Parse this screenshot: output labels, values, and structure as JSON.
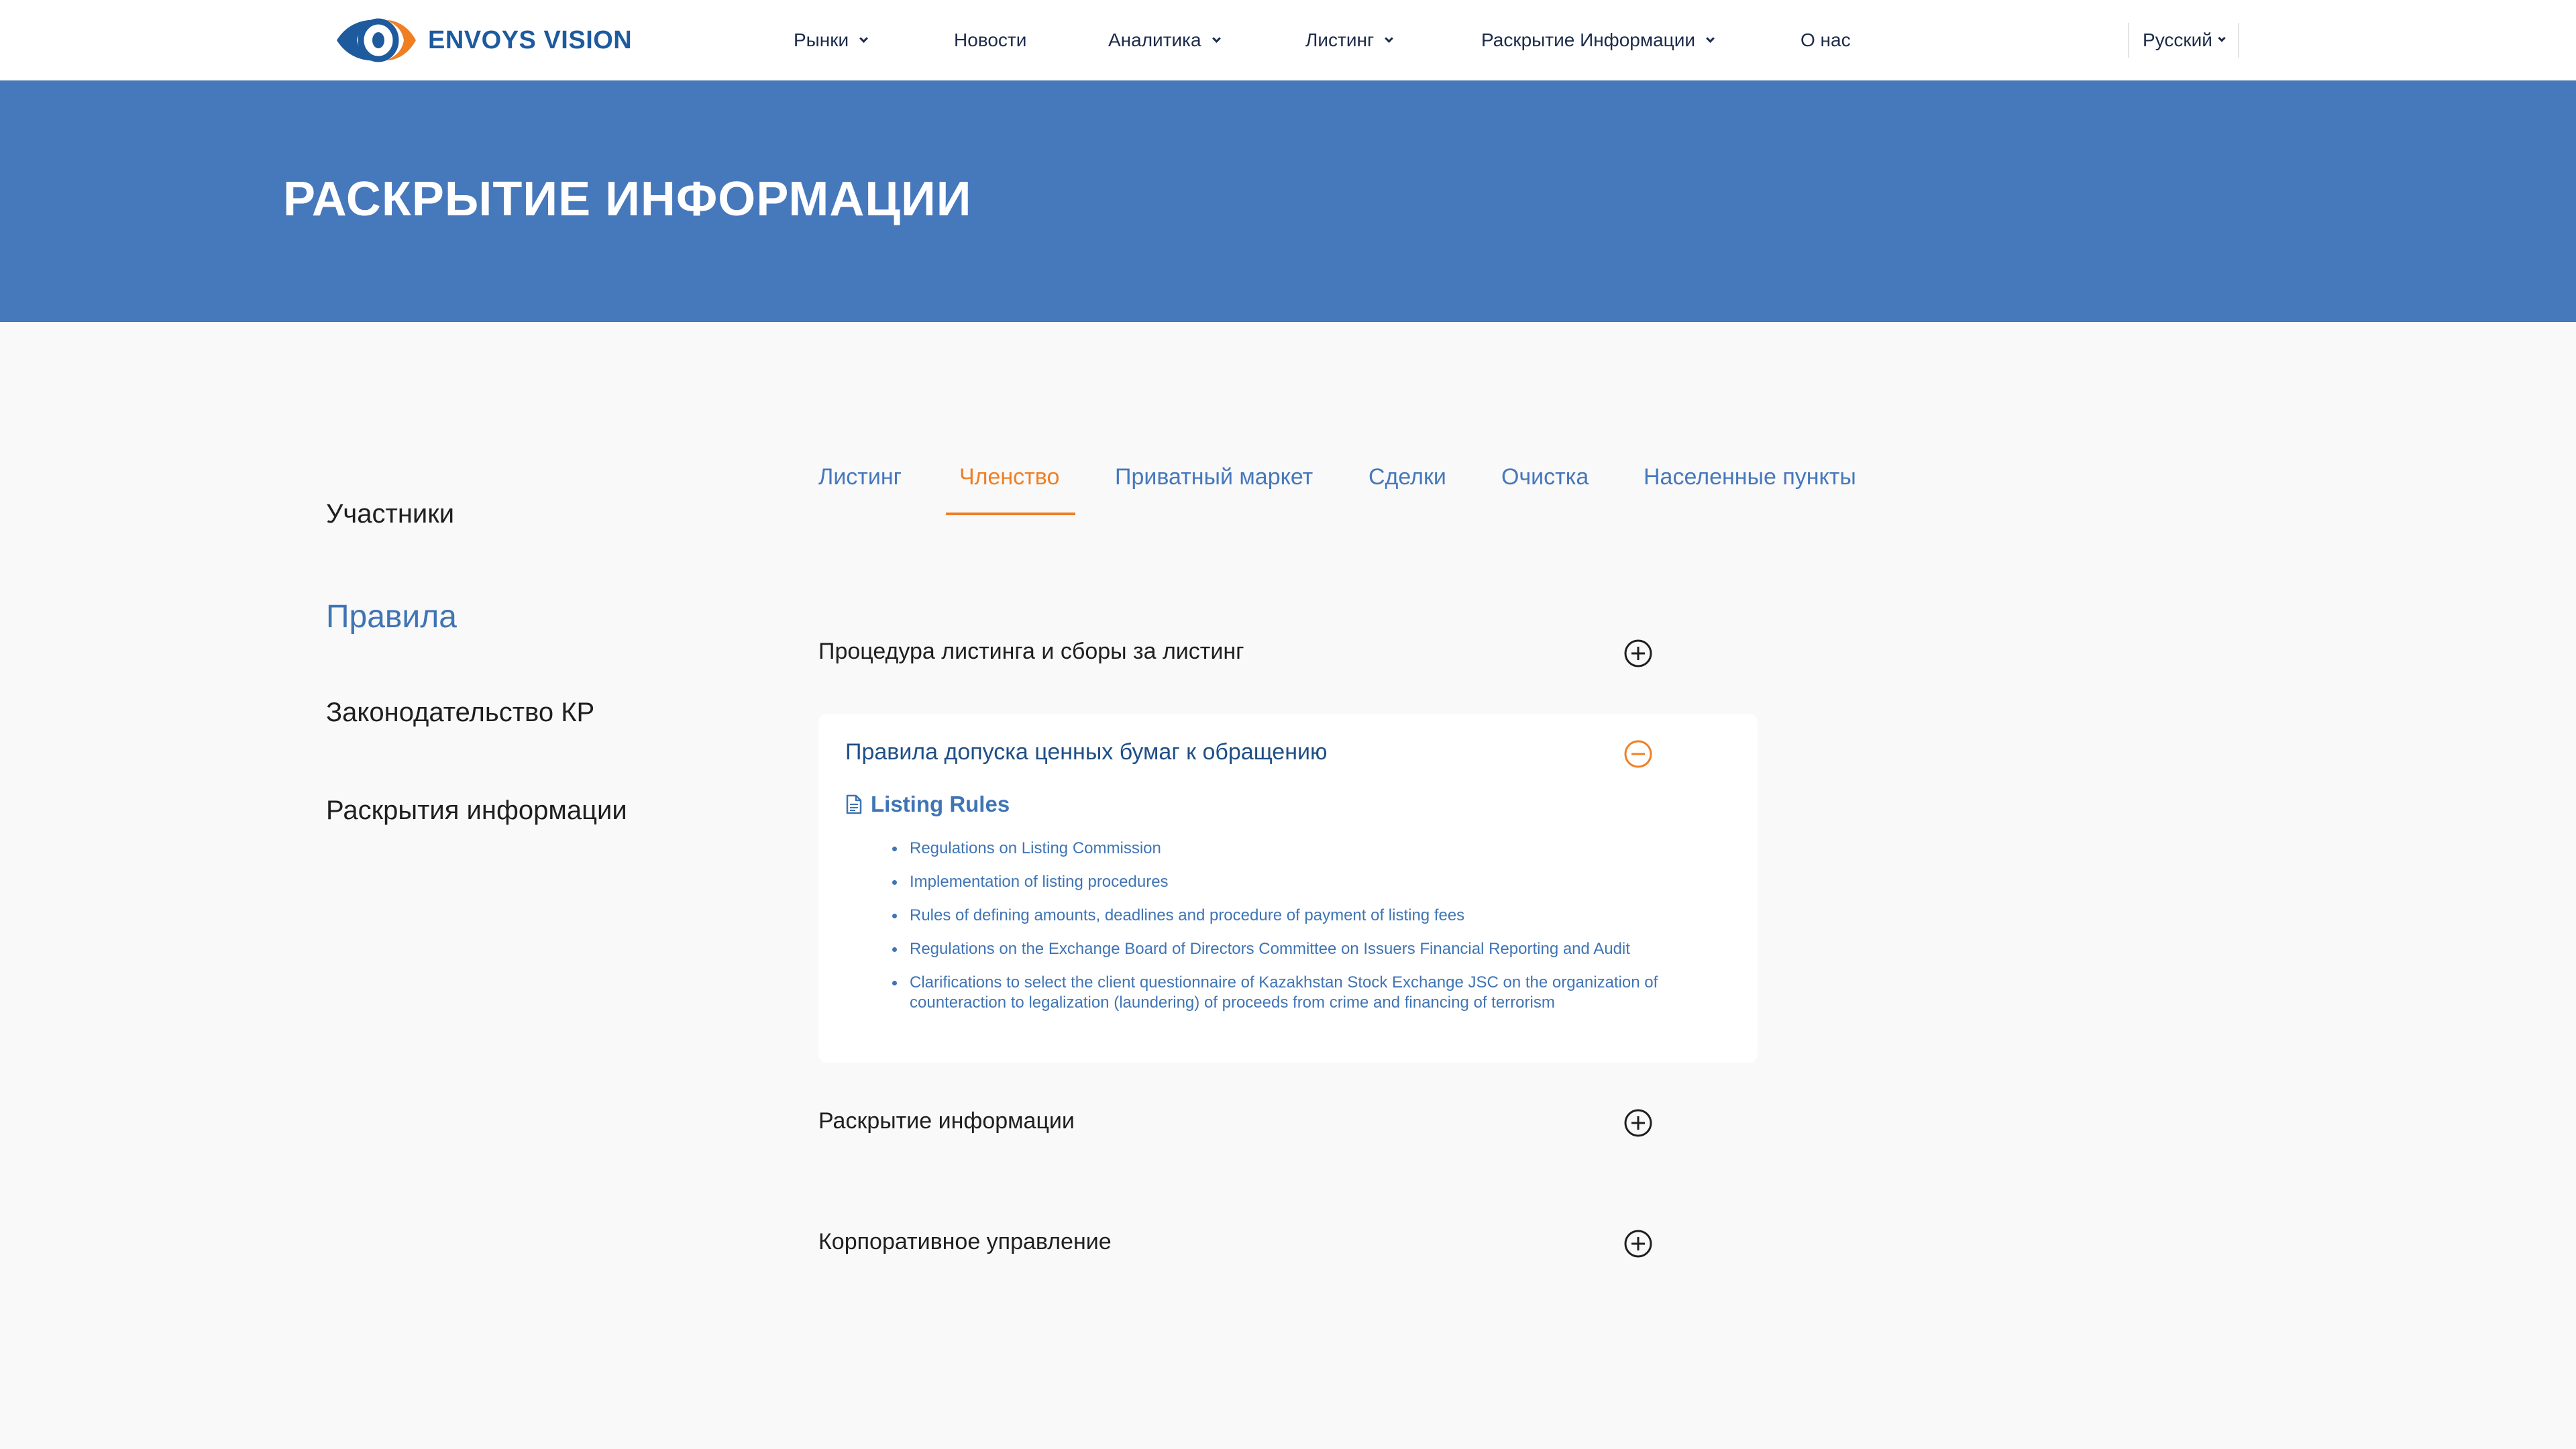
{
  "header": {
    "brand": "ENVOYS VISION",
    "nav": [
      {
        "label": "Рынки",
        "has_dropdown": true
      },
      {
        "label": "Новости",
        "has_dropdown": false
      },
      {
        "label": "Аналитика",
        "has_dropdown": true
      },
      {
        "label": "Листинг",
        "has_dropdown": true
      },
      {
        "label": "Раскрытие Информации",
        "has_dropdown": true
      },
      {
        "label": "О нас",
        "has_dropdown": false
      }
    ],
    "language": "Русский"
  },
  "banner": {
    "title": "РАСКРЫТИЕ ИНФОРМАЦИИ"
  },
  "sidebar": {
    "items": [
      {
        "label": "Участники",
        "active": false
      },
      {
        "label": "Правила",
        "active": true
      },
      {
        "label": "Законодательство КР",
        "active": false
      },
      {
        "label": "Раскрытия информации",
        "active": false
      }
    ]
  },
  "tabs": [
    {
      "label": "Листинг",
      "active": false
    },
    {
      "label": "Членство",
      "active": true
    },
    {
      "label": "Приватный маркет",
      "active": false
    },
    {
      "label": "Сделки",
      "active": false
    },
    {
      "label": "Очистка",
      "active": false
    },
    {
      "label": "Населенные пункты",
      "active": false
    }
  ],
  "accordion": [
    {
      "title": "Процедура листинга и сборы за листинг",
      "expanded": false,
      "icon": "plus-circle-icon"
    },
    {
      "title": "Правила допуска ценных бумаг к обращению",
      "expanded": true,
      "icon": "minus-circle-icon",
      "document": {
        "icon": "document-icon",
        "title": "Listing Rules",
        "items": [
          "Regulations on Listing Commission",
          "Implementation of listing procedures",
          "Rules of defining amounts, deadlines and procedure of payment of listing fees",
          "Regulations on the Exchange Board of Directors Committee on Issuers Financial Reporting and Audit",
          "Clarifications to select the client questionnaire of Kazakhstan Stock Exchange JSC on the organization of counteraction to legalization (laundering) of proceeds from crime and financing of terrorism"
        ]
      }
    },
    {
      "title": "Раскрытие информации",
      "expanded": false,
      "icon": "plus-circle-icon"
    },
    {
      "title": "Корпоративное управление",
      "expanded": false,
      "icon": "plus-circle-icon"
    }
  ],
  "colors": {
    "banner": "#4678bc",
    "link": "#3f74b5",
    "accent": "#f07f24",
    "background": "#f9f9f9"
  }
}
